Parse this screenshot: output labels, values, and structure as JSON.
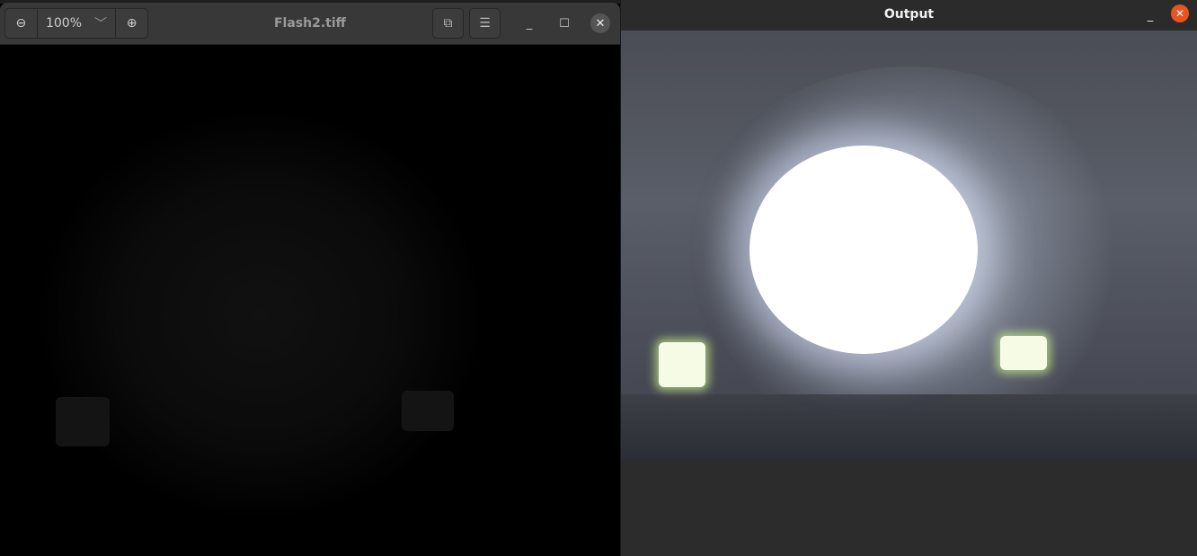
{
  "viewer": {
    "title": "Flash2.tiff",
    "zoom": "100%",
    "zoom_out_icon": "zoom-out-icon",
    "zoom_in_icon": "zoom-in-icon"
  },
  "output": {
    "title": "Output"
  },
  "colors": {
    "close_accent": "#e95420"
  }
}
